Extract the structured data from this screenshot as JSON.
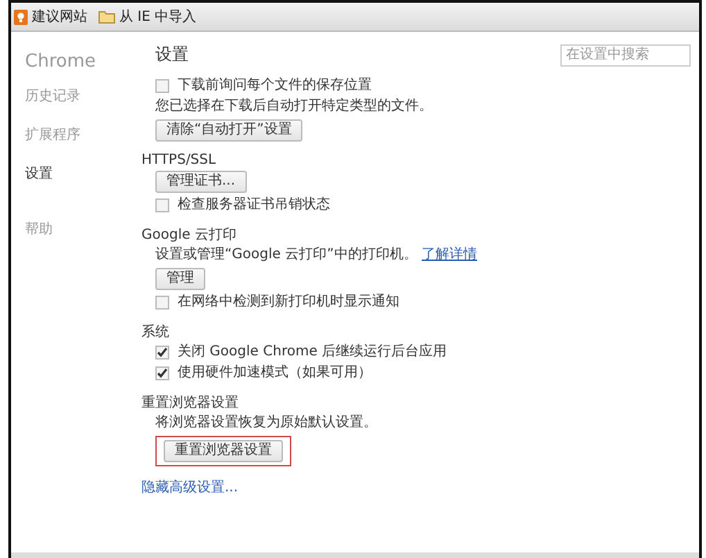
{
  "bookmarks": [
    {
      "label": "建议网站",
      "kind": "site"
    },
    {
      "label": "从 IE 中导入",
      "kind": "folder"
    }
  ],
  "sidebar": {
    "title": "Chrome",
    "items": [
      {
        "label": "历史记录",
        "selected": false
      },
      {
        "label": "扩展程序",
        "selected": false
      },
      {
        "label": "设置",
        "selected": true
      },
      {
        "label": "帮助",
        "selected": false
      }
    ]
  },
  "page_title": "设置",
  "search": {
    "placeholder": "在设置中搜索"
  },
  "sections": [
    {
      "items": [
        {
          "kind": "checkbox",
          "label": "下载前询问每个文件的保存位置",
          "checked": false
        },
        {
          "kind": "text",
          "text": "您已选择在下载后自动打开特定类型的文件。"
        },
        {
          "kind": "button",
          "label": "清除“自动打开”设置",
          "highlighted": false
        }
      ]
    },
    {
      "heading": "HTTPS/SSL",
      "items": [
        {
          "kind": "button",
          "label": "管理证书...",
          "highlighted": false
        },
        {
          "kind": "checkbox",
          "label": "检查服务器证书吊销状态",
          "checked": false
        }
      ]
    },
    {
      "heading": "Google 云打印",
      "items": [
        {
          "kind": "text",
          "text": "设置或管理“Google 云打印”中的打印机。",
          "link": "了解详情"
        },
        {
          "kind": "button",
          "label": "管理",
          "highlighted": false
        },
        {
          "kind": "checkbox",
          "label": "在网络中检测到新打印机时显示通知",
          "checked": false
        }
      ]
    },
    {
      "heading": "系统",
      "items": [
        {
          "kind": "checkbox",
          "label": "关闭 Google Chrome 后继续运行后台应用",
          "checked": true
        },
        {
          "kind": "checkbox",
          "label": "使用硬件加速模式（如果可用）",
          "checked": true
        }
      ]
    },
    {
      "heading": "重置浏览器设置",
      "items": [
        {
          "kind": "text",
          "text": "将浏览器设置恢复为原始默认设置。"
        },
        {
          "kind": "button",
          "label": "重置浏览器设置",
          "highlighted": true
        }
      ]
    }
  ],
  "footer_link": "隐藏高级设置..."
}
